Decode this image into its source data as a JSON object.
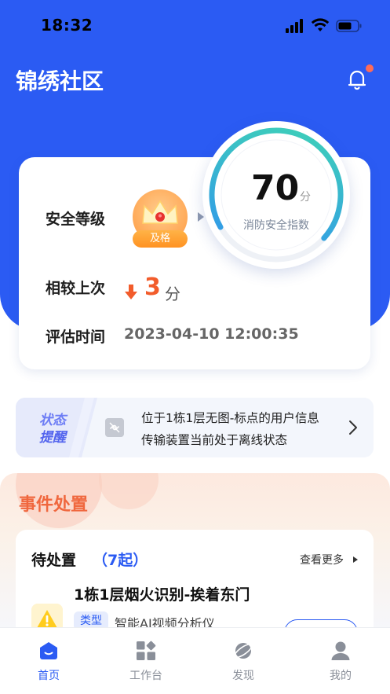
{
  "status_bar": {
    "time": "18:32"
  },
  "header": {
    "title": "锦绣社区",
    "notification_dot": true
  },
  "safety_card": {
    "level_label": "安全等级",
    "level_badge": "及格",
    "compare_label": "相较上次",
    "compare_value": "3",
    "compare_unit": "分",
    "compare_direction": "down",
    "eval_label": "评估时间",
    "eval_time": "2023-04-10 12:00:35",
    "score": "70",
    "score_unit": "分",
    "score_label": "消防安全指数",
    "score_gauge_fraction": 0.7
  },
  "notice": {
    "badge_line1": "状态",
    "badge_line2": "提醒",
    "line1": "位于1栋1层无图-标点的用户信息",
    "line2": "传输装置当前处于离线状态"
  },
  "events": {
    "section_title": "事件处置",
    "pending_label": "待处置",
    "pending_count": "（7起）",
    "see_more": "查看更多",
    "items": [
      {
        "name": "1栋1层烟火识别-挨着东门",
        "type_tag": "类型",
        "type_value": "智能AI视频分析仪"
      }
    ]
  },
  "tabbar": {
    "items": [
      {
        "label": "首页",
        "active": true
      },
      {
        "label": "工作台",
        "active": false
      },
      {
        "label": "发现",
        "active": false
      },
      {
        "label": "我的",
        "active": false
      }
    ]
  },
  "colors": {
    "primary": "#2b5bf3",
    "accent_orange": "#f25c2b",
    "gauge_start": "#3fd6b3",
    "gauge_end": "#2f8cf5"
  }
}
